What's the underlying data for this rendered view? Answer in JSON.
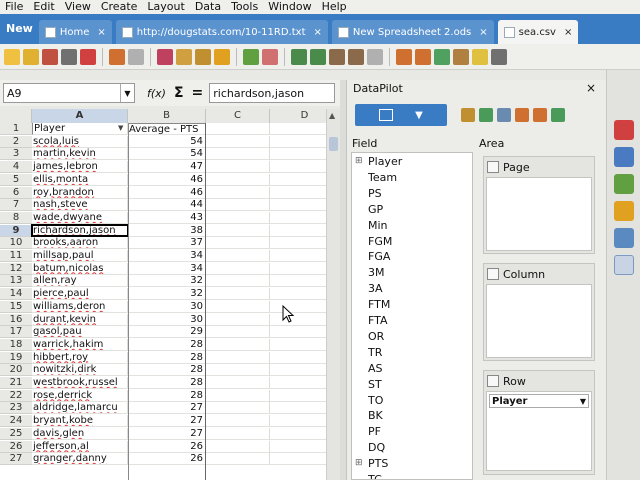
{
  "menu": [
    "File",
    "Edit",
    "View",
    "Create",
    "Layout",
    "Data",
    "Tools",
    "Window",
    "Help"
  ],
  "tabs": {
    "new_label": "New",
    "items": [
      {
        "label": "Home",
        "active": false
      },
      {
        "label": "http://dougstats.com/10-11RD.txt",
        "active": false
      },
      {
        "label": "New Spreadsheet 2.ods",
        "active": false
      },
      {
        "label": "sea.csv",
        "active": true
      }
    ]
  },
  "formula": {
    "cell_ref": "A9",
    "fx": "f(x)",
    "sigma": "Σ",
    "eq": "=",
    "content": "richardson,jason"
  },
  "sheet": {
    "columns": [
      "A",
      "B",
      "C",
      "D"
    ],
    "selected_cell": "A9",
    "rows": [
      {
        "n": "1",
        "a": "Player",
        "b": "Average - PTS"
      },
      {
        "n": "2",
        "a": "scola,luis",
        "b": "54"
      },
      {
        "n": "3",
        "a": "martin,kevin",
        "b": "54"
      },
      {
        "n": "4",
        "a": "james,lebron",
        "b": "47"
      },
      {
        "n": "5",
        "a": "ellis,monta",
        "b": "46"
      },
      {
        "n": "6",
        "a": "roy,brandon",
        "b": "46"
      },
      {
        "n": "7",
        "a": "nash,steve",
        "b": "44"
      },
      {
        "n": "8",
        "a": "wade,dwyane",
        "b": "43"
      },
      {
        "n": "9",
        "a": "richardson,jason",
        "b": "38"
      },
      {
        "n": "10",
        "a": "brooks,aaron",
        "b": "37"
      },
      {
        "n": "11",
        "a": "millsap,paul",
        "b": "34"
      },
      {
        "n": "12",
        "a": "batum,nicolas",
        "b": "34"
      },
      {
        "n": "13",
        "a": "allen,ray",
        "b": "32"
      },
      {
        "n": "14",
        "a": "pierce,paul",
        "b": "32"
      },
      {
        "n": "15",
        "a": "williams,deron",
        "b": "30"
      },
      {
        "n": "16",
        "a": "durant,kevin",
        "b": "30"
      },
      {
        "n": "17",
        "a": "gasol,pau",
        "b": "29"
      },
      {
        "n": "18",
        "a": "warrick,hakim",
        "b": "28"
      },
      {
        "n": "19",
        "a": "hibbert,roy",
        "b": "28"
      },
      {
        "n": "20",
        "a": "nowitzki,dirk",
        "b": "28"
      },
      {
        "n": "21",
        "a": "westbrook,russel",
        "b": "28"
      },
      {
        "n": "22",
        "a": "rose,derrick",
        "b": "28"
      },
      {
        "n": "23",
        "a": "aldridge,lamarcu",
        "b": "27"
      },
      {
        "n": "24",
        "a": "bryant,kobe",
        "b": "27"
      },
      {
        "n": "25",
        "a": "davis,glen",
        "b": "27"
      },
      {
        "n": "26",
        "a": "jefferson,al",
        "b": "26"
      },
      {
        "n": "27",
        "a": "granger,danny",
        "b": "26"
      }
    ]
  },
  "datapilot": {
    "title": "DataPilot",
    "close": "×",
    "field_label": "Field",
    "area_label": "Area",
    "fields": [
      "Player",
      "Team",
      "PS",
      "GP",
      "Min",
      "FGM",
      "FGA",
      "3M",
      "3A",
      "FTM",
      "FTA",
      "OR",
      "TR",
      "AS",
      "ST",
      "TO",
      "BK",
      "PF",
      "DQ",
      "PTS",
      "TC"
    ],
    "areas": {
      "page": "Page",
      "column": "Column",
      "row": "Row",
      "row_field": "Player"
    }
  },
  "colors": {
    "accent": "#3a7cc4",
    "selection": "#c9d6e8"
  }
}
